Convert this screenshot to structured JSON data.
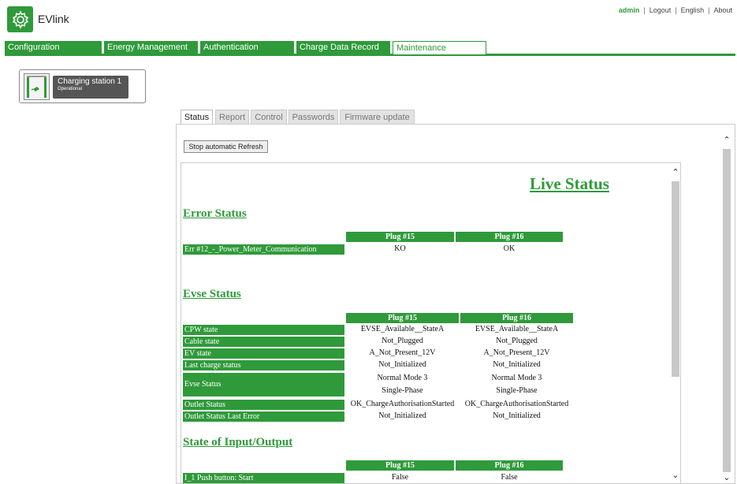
{
  "header": {
    "app_title": "EVlink",
    "user": "admin",
    "links": [
      "Logout",
      "English",
      "About"
    ]
  },
  "nav": {
    "tabs": [
      "Configuration",
      "Energy Management",
      "Authentication",
      "Charge Data Record",
      "Maintenance"
    ],
    "active": "Maintenance"
  },
  "station": {
    "name": "Charging station 1",
    "state": "Operational"
  },
  "sub_tabs": {
    "tabs": [
      "Status",
      "Report",
      "Control",
      "Passwords",
      "Firmware update"
    ],
    "active": "Status"
  },
  "refresh_button": "Stop automatic Refresh",
  "live_status_title": "Live Status",
  "error_status": {
    "title": "Error Status",
    "columns": [
      "Plug #15",
      "Plug #16"
    ],
    "rows": [
      {
        "label": "Err #12_-_Power_Meter_Communication",
        "values": [
          "KO",
          "OK"
        ]
      }
    ]
  },
  "evse_status": {
    "title": "Evse Status",
    "columns": [
      "Plug #15",
      "Plug #16"
    ],
    "rows": [
      {
        "label": "CPW state",
        "values": [
          "EVSE_Available__StateA",
          "EVSE_Available__StateA"
        ]
      },
      {
        "label": "Cable state",
        "values": [
          "Not_Plugged",
          "Not_Plugged"
        ]
      },
      {
        "label": "EV state",
        "values": [
          "A_Not_Present_12V",
          "A_Not_Present_12V"
        ]
      },
      {
        "label": "Last charge status",
        "values": [
          "Not_Initialized",
          "Not_Initialized"
        ]
      },
      {
        "label": "Evse Status",
        "values": [
          "Normal Mode 3",
          "Normal Mode 3"
        ],
        "values_line2": [
          "Single-Phase",
          "Single-Phase"
        ]
      },
      {
        "label": "Outlet Status",
        "values": [
          "OK_ChargeAuthorisationStarted",
          "OK_ChargeAuthorisationStarted"
        ]
      },
      {
        "label": "Outlet Status Last Error",
        "values": [
          "Not_Initialized",
          "Not_Initialized"
        ]
      }
    ]
  },
  "io_status": {
    "title": "State of Input/Output",
    "columns": [
      "Plug #15",
      "Plug #16"
    ],
    "rows": [
      {
        "label": "I_1 Push button: Start",
        "values": [
          "False",
          "False"
        ]
      }
    ]
  },
  "colors": {
    "accent": "#2f9a3a",
    "station_label_bg": "#555555"
  },
  "icons": [
    "gear-logo-icon",
    "charging-station-icon",
    "scroll-up-icon",
    "scroll-down-icon"
  ]
}
